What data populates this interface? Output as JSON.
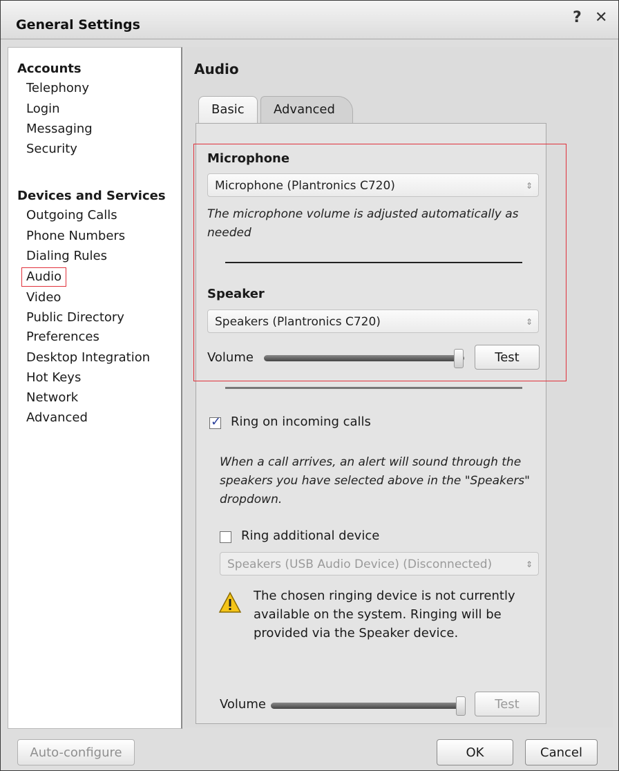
{
  "window": {
    "title": "General Settings",
    "help_label": "?",
    "close_label": "✕"
  },
  "sidebar": {
    "groups": [
      {
        "label": "Accounts",
        "items": [
          "Telephony",
          "Login",
          "Messaging",
          "Security"
        ]
      },
      {
        "label": "Devices and Services",
        "items": [
          "Outgoing Calls",
          "Phone Numbers",
          "Dialing Rules",
          "Audio",
          "Video",
          "Public Directory",
          "Preferences",
          "Desktop Integration",
          "Hot Keys",
          "Network",
          "Advanced"
        ]
      }
    ],
    "selected": "Audio"
  },
  "main": {
    "title": "Audio",
    "tabs": [
      {
        "label": "Basic",
        "active": true
      },
      {
        "label": "Advanced",
        "active": false
      }
    ],
    "microphone": {
      "label": "Microphone",
      "device": "Microphone (Plantronics C720)",
      "note": "The microphone volume is adjusted automatically as needed"
    },
    "speaker": {
      "label": "Speaker",
      "device": "Speakers (Plantronics C720)",
      "volume_label": "Volume",
      "volume_level": 0.97,
      "test_label": "Test"
    },
    "ring": {
      "checkbox_label": "Ring on incoming calls",
      "checked": true,
      "note": "When a call arrives, an alert will sound through the speakers you have selected above in the \"Speakers\" dropdown.",
      "additional_label": "Ring additional device",
      "additional_checked": false,
      "additional_device": "Speakers (USB Audio Device) (Disconnected)",
      "warning": "The chosen ringing device is not currently available on the system. Ringing will be provided via the Speaker device.",
      "volume_label": "Volume",
      "volume_level": 0.97,
      "test_label": "Test"
    }
  },
  "footer": {
    "autoconfigure_label": "Auto-configure",
    "ok_label": "OK",
    "cancel_label": "Cancel"
  },
  "colors": {
    "highlight": "#e0303a",
    "checkbox_tick": "#2a3f9a"
  }
}
